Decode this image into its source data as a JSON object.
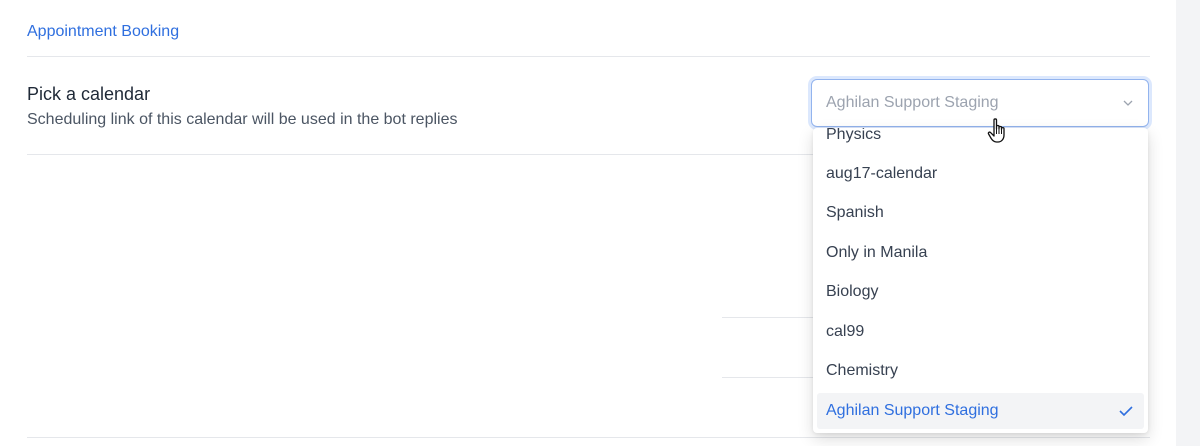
{
  "section": {
    "link_label": "Appointment Booking"
  },
  "field": {
    "title": "Pick a calendar",
    "description": "Scheduling link of this calendar will be used in the bot replies"
  },
  "select": {
    "value": "Aghilan Support Staging",
    "icon": "chevron-down-icon"
  },
  "dropdown": {
    "options": [
      {
        "label": "Physics"
      },
      {
        "label": "aug17-calendar"
      },
      {
        "label": "Spanish"
      },
      {
        "label": "Only in Manila"
      },
      {
        "label": "Biology"
      },
      {
        "label": "cal99"
      },
      {
        "label": "Chemistry"
      },
      {
        "label": "Aghilan Support Staging",
        "selected": true
      }
    ],
    "check_icon": "check-icon"
  },
  "colors": {
    "accent": "#2f6fdf",
    "focus_border": "#93b4ee",
    "selected_bg": "#f3f4f6"
  }
}
